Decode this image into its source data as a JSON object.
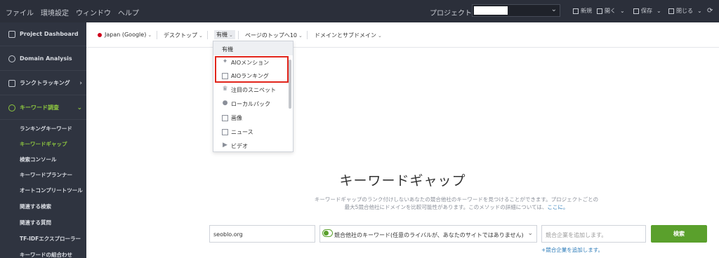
{
  "topbar": {
    "menu": [
      "ファイル",
      "環境設定",
      "ウィンドウ",
      "ヘルプ"
    ],
    "project_label": "プロジェクト：",
    "tools": [
      {
        "label": "新規",
        "icon": "new-icon"
      },
      {
        "label": "開く",
        "icon": "folder-icon"
      },
      {
        "label": "保存",
        "icon": "save-icon"
      },
      {
        "label": "閉じる",
        "icon": "close-icon"
      }
    ]
  },
  "sidebar": {
    "items": [
      {
        "label": "Project Dashboard",
        "icon": "dashboard-icon"
      },
      {
        "label": "Domain Analysis",
        "icon": "globe-icon"
      },
      {
        "label": "ランクトラッキング",
        "icon": "chart-icon"
      },
      {
        "label": "キーワード調査",
        "icon": "search-icon"
      }
    ],
    "subitems": [
      "ランキングキーワード",
      "キーワードギャップ",
      "検索コンソール",
      "キーワードプランナー",
      "オートコンプリートツール",
      "関連する検索",
      "関連する質問",
      "TF-IDFエクスプローラー",
      "キーワードの組合わせ"
    ]
  },
  "filters": {
    "country": "Japan (Google)",
    "device": "デスクトップ",
    "type": "有機",
    "top": "ページのトップへ10",
    "domain": "ドメインとサブドメイン"
  },
  "dropdown": {
    "header": "有機",
    "items": [
      {
        "label": "AIOメンション",
        "icon": "sparkle-icon"
      },
      {
        "label": "AIOランキング",
        "icon": "document-icon"
      },
      {
        "label": "注目のスニペット",
        "icon": "crown-icon"
      },
      {
        "label": "ローカルパック",
        "icon": "map-pin-icon"
      },
      {
        "label": "画像",
        "icon": "image-icon"
      },
      {
        "label": "ニュース",
        "icon": "news-icon"
      },
      {
        "label": "ビデオ",
        "icon": "video-icon"
      }
    ]
  },
  "main": {
    "title": "キーワードギャップ",
    "desc_line1": "キーワードギャップのランク付けしないあなたの競合他社のキーワードを見つけることができます。プロジェクトごとの",
    "desc_line2": "最大5競合他社にドメインを比較可能性があります。このメソッドの詳細については、",
    "desc_link": "ここに。",
    "domain_value": "seoblo.org",
    "keyword_select": "競合他社のキーワード(任意のライバルが、あなたのサイトではありません)",
    "competitor_placeholder": "競合企業を追加します。",
    "search_button": "検索",
    "add_link": "+競合企業を追加します。"
  },
  "colors": {
    "accent_green": "#8dc63f",
    "button_green": "#5aa02c",
    "highlight_red": "#e1251b",
    "sidebar_bg": "#2f3440",
    "topbar_bg": "#2b2f3a"
  }
}
